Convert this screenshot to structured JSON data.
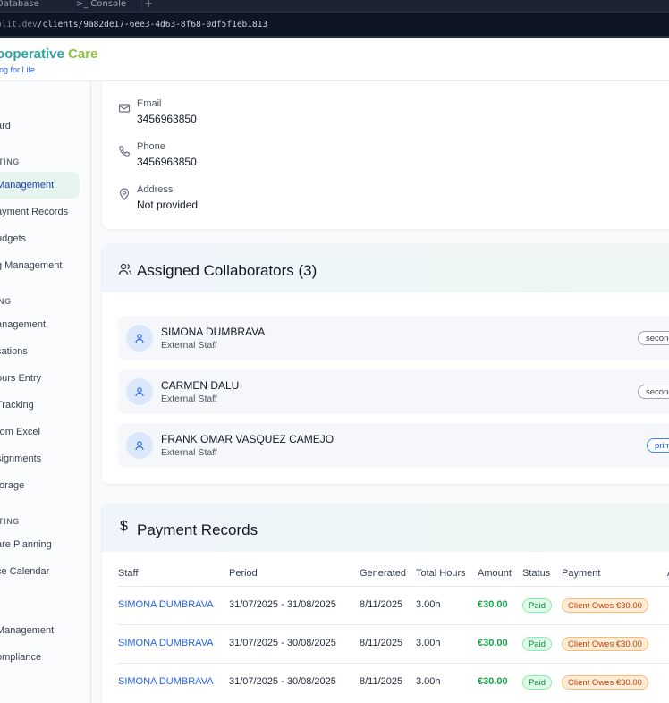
{
  "browser": {
    "tabs": [
      {
        "label": "Database",
        "icon": "database-icon"
      },
      {
        "label": "Console",
        "icon": "terminal-icon"
      }
    ],
    "new_tab": "+",
    "url_prefix": "plit.dev",
    "url_path": "/clients/9a82de17-6ee3-4d63-8f68-0df5f1eb1813"
  },
  "header": {
    "brand_main": "ooperative ",
    "brand_accent": "Care",
    "tagline": "ing for Life"
  },
  "sidebar": {
    "items": [
      {
        "label": "ard"
      },
      {
        "section": "TING"
      },
      {
        "label": "Management",
        "active": true
      },
      {
        "label": "ayment Records"
      },
      {
        "label": "udgets"
      },
      {
        "label": "g Management"
      },
      {
        "section": "NG"
      },
      {
        "label": "anagement"
      },
      {
        "label": "sations"
      },
      {
        "label": "ours Entry"
      },
      {
        "label": " Tracking"
      },
      {
        "label": "rom Excel"
      },
      {
        "label": "signments"
      },
      {
        "label": "torage"
      },
      {
        "section": "TING"
      },
      {
        "label": "are Planning"
      },
      {
        "label": "ce Calendar"
      },
      {
        "label": "Management"
      },
      {
        "label": "ompliance"
      }
    ]
  },
  "contact": {
    "email_label": "Email",
    "email_value": "3456963850",
    "phone_label": "Phone",
    "phone_value": "3456963850",
    "address_label": "Address",
    "address_value": "Not provided"
  },
  "collaborators": {
    "title": "Assigned Collaborators (3)",
    "items": [
      {
        "name": "SIMONA DUMBRAVA",
        "role": "External Staff",
        "badge": "second"
      },
      {
        "name": "CARMEN DALU",
        "role": "External Staff",
        "badge": "second"
      },
      {
        "name": "FRANK OMAR VASQUEZ CAMEJO",
        "role": "External Staff",
        "badge": "prim"
      }
    ]
  },
  "payments": {
    "title": "Payment Records",
    "columns": [
      "Staff",
      "Period",
      "Generated",
      "Total Hours",
      "Amount",
      "Status",
      "Payment",
      "A"
    ],
    "rows": [
      {
        "staff": "SIMONA DUMBRAVA",
        "period": "31/07/2025 - 31/08/2025",
        "generated": "8/11/2025",
        "hours": "3.00h",
        "amount": "€30.00",
        "status": "Paid",
        "payment": "Client Owes €30.00"
      },
      {
        "staff": "SIMONA DUMBRAVA",
        "period": "31/07/2025 - 30/08/2025",
        "generated": "8/11/2025",
        "hours": "3.00h",
        "amount": "€30.00",
        "status": "Paid",
        "payment": "Client Owes €30.00"
      },
      {
        "staff": "SIMONA DUMBRAVA",
        "period": "31/07/2025 - 30/08/2025",
        "generated": "8/11/2025",
        "hours": "3.00h",
        "amount": "€30.00",
        "status": "Paid",
        "payment": "Client Owes €30.00"
      }
    ]
  },
  "colors": {
    "brand_teal": "#2aa6a0",
    "brand_green": "#8ac43f",
    "link_blue": "#2563eb",
    "amount_green": "#16a34a",
    "active_nav_bg": "#e6f6ee"
  }
}
